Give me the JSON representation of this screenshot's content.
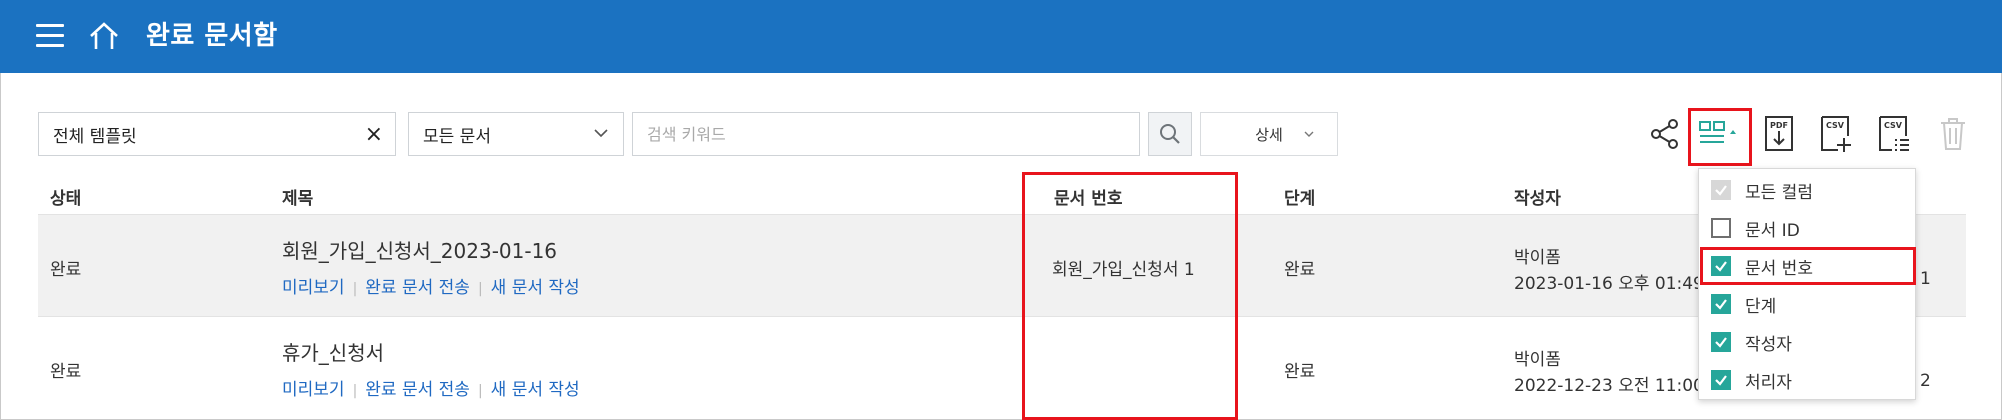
{
  "header": {
    "title": "완료 문서함"
  },
  "toolbar": {
    "template_value": "전체 템플릿",
    "clear_glyph": "×",
    "doc_filter_value": "모든 문서",
    "search_placeholder": "검색 키워드",
    "detail_label": "상세",
    "icons": [
      "share-icon",
      "columns-icon",
      "pdf-download-icon",
      "csv-add-icon",
      "csv-list-icon",
      "trash-icon"
    ],
    "pdf_label": "PDF",
    "csv_label": "CSV"
  },
  "table": {
    "headers": {
      "status": "상태",
      "subject": "제목",
      "docnum": "문서 번호",
      "stage": "단계",
      "author": "작성자"
    },
    "rows": [
      {
        "status": "완료",
        "subject": "회원_가입_신청서_2023-01-16",
        "links": [
          "미리보기",
          "완료 문서 전송",
          "새 문서 작성"
        ],
        "docnum": "회원_가입_신청서 1",
        "stage": "완료",
        "author": "박이폼",
        "date": "2023-01-16 오후 01:49",
        "trailing": "1"
      },
      {
        "status": "완료",
        "subject": "휴가_신청서",
        "links": [
          "미리보기",
          "완료 문서 전송",
          "새 문서 작성"
        ],
        "docnum": "",
        "stage": "완료",
        "author": "박이폼",
        "date": "2022-12-23 오전 11:00",
        "trailing": "2"
      }
    ]
  },
  "column_menu": {
    "items": [
      {
        "label": "모든 컬럼",
        "state": "disabled-checked"
      },
      {
        "label": "문서 ID",
        "state": "unchecked"
      },
      {
        "label": "문서 번호",
        "state": "checked"
      },
      {
        "label": "단계",
        "state": "checked"
      },
      {
        "label": "작성자",
        "state": "checked"
      },
      {
        "label": "처리자",
        "state": "checked"
      }
    ]
  },
  "colors": {
    "header_bg": "#1b72c1",
    "accent_teal": "#26a69a",
    "link_blue": "#1f69c2",
    "highlight_red": "#e8141c"
  }
}
